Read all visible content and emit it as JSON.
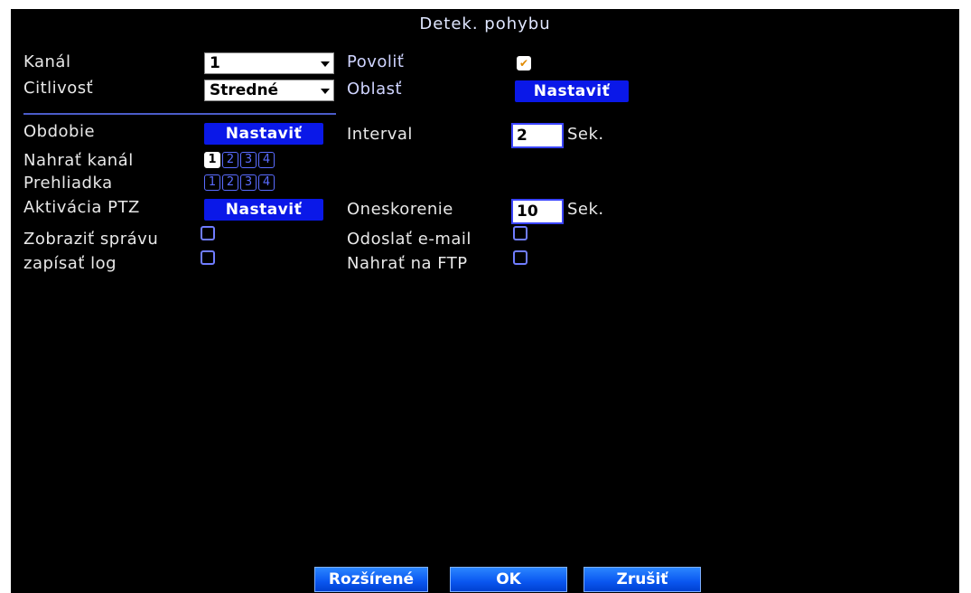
{
  "title": "Detek. pohybu",
  "colors": {
    "accent": "#0a18e8",
    "background": "#000000",
    "text": "#e8e8e8"
  },
  "labels": {
    "kanal": "Kanál",
    "citlivost": "Citlivosť",
    "povolit": "Povoliť",
    "oblast": "Oblasť",
    "obdobie": "Obdobie",
    "interval": "Interval",
    "nahrat_kanal": "Nahrať kanál",
    "prehliadka": "Prehliadka",
    "aktivacia_ptz": "Aktivácia PTZ",
    "oneskorenie": "Oneskorenie",
    "zobrazit_spravu": "Zobraziť správu",
    "odoslat_email": "Odoslať e-mail",
    "zapisat_log": "zapísať log",
    "nahrat_ftp": "Nahrať na FTP"
  },
  "fields": {
    "kanal_value": "1",
    "citlivost_value": "Stredné",
    "interval_value": "2",
    "interval_unit": "Sek.",
    "oneskorenie_value": "10",
    "oneskorenie_unit": "Sek."
  },
  "buttons": {
    "nastavit": "Nastaviť",
    "rozsirene": "Rozšírené",
    "ok": "OK",
    "zrusit": "Zrušiť"
  },
  "record_channels": [
    "1",
    "2",
    "3",
    "4"
  ],
  "tour_channels": [
    "1",
    "2",
    "3",
    "4"
  ],
  "checks": {
    "povolit": "✔"
  }
}
